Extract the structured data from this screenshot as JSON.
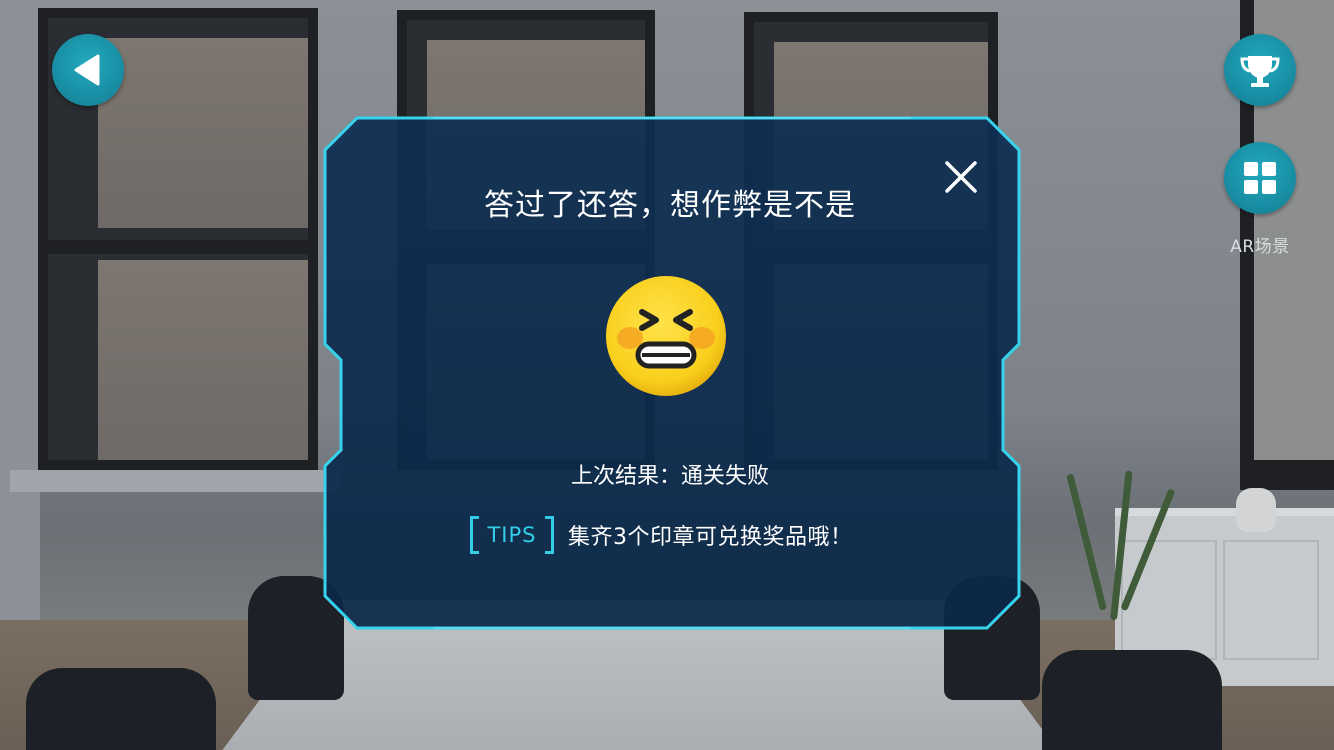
{
  "dialog": {
    "title": "答过了还答，想作弊是不是",
    "result_text": "上次结果：通关失败",
    "tips_label": "TIPS",
    "tips_text": "集齐3个印章可兑换奖品哦！"
  },
  "hud": {
    "ar_scene_label": "AR场景",
    "icons": [
      "back-arrow-icon",
      "trophy-icon",
      "grid-icon",
      "close-icon"
    ]
  },
  "colors": {
    "accent_cyan": "#32cde6",
    "dialog_bg": "#0d2b4f",
    "button_teal": "#178aa0",
    "emoji_yellow": "#fbd325"
  }
}
